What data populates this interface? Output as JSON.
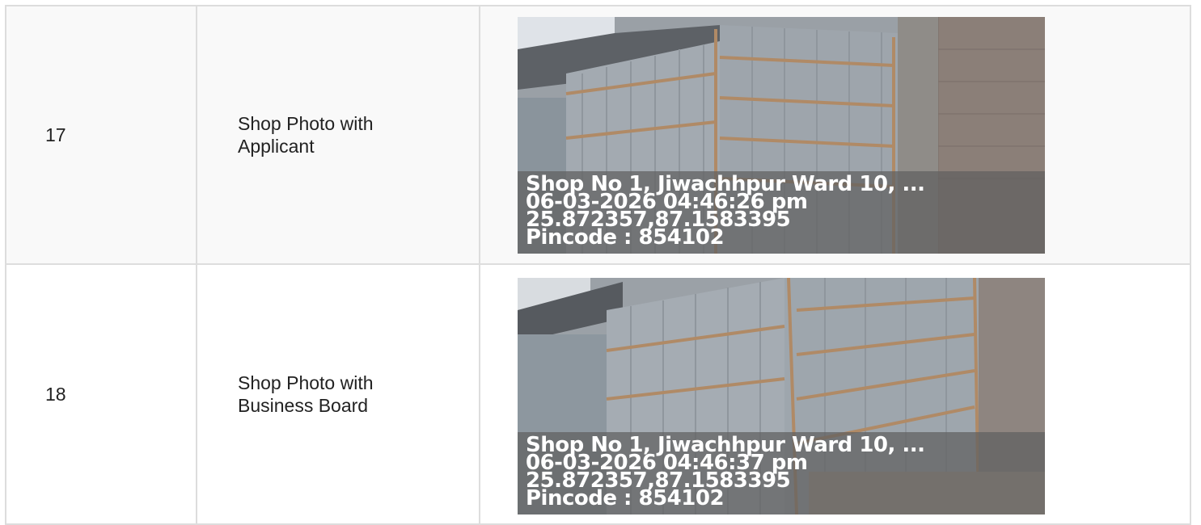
{
  "rows": [
    {
      "number": "17",
      "label": "Shop Photo with\nApplicant",
      "photo": {
        "address": "Shop No 1, Jiwachhpur Ward 10, ...",
        "datetime": "06-03-2026 04:46:26 pm",
        "coordinates": "25.872357,87.1583395",
        "pincode": "Pincode : 854102"
      }
    },
    {
      "number": "18",
      "label": "Shop Photo with\nBusiness Board",
      "photo": {
        "address": "Shop No 1, Jiwachhpur Ward 10, ...",
        "datetime": "06-03-2026 04:46:37 pm",
        "coordinates": "25.872357,87.1583395",
        "pincode": "Pincode : 854102"
      }
    }
  ],
  "colors": {
    "border": "#dddddd",
    "odd_row_bg": "#f9f9f9",
    "overlay_text": "#ffffff"
  }
}
